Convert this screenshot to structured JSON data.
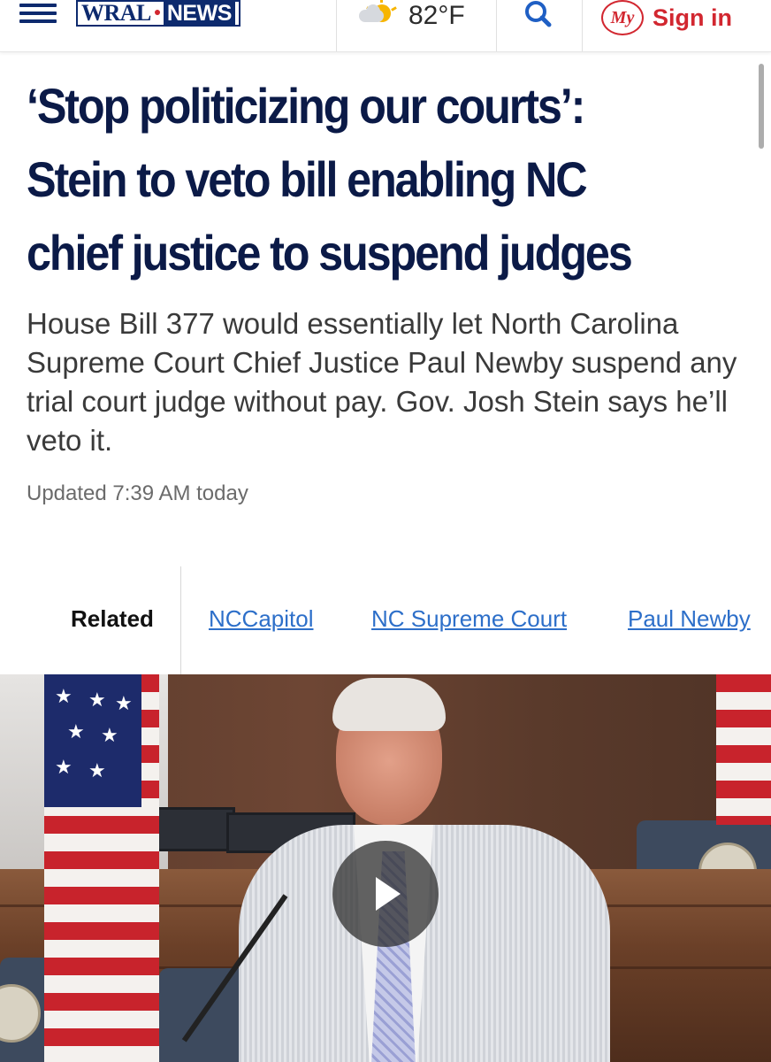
{
  "header": {
    "logo_text": "WRAL",
    "logo_news": "NEWS",
    "weather_icon": "partly-cloudy-icon",
    "temperature": "82°F",
    "search_icon": "search-icon",
    "my_badge": "My",
    "signin_label": "Sign in"
  },
  "article": {
    "headline": "‘Stop politicizing our courts’: Stein to veto bill enabling NC chief justice to suspend judges",
    "subhead": "House Bill 377 would essentially let North Carolina Supreme Court Chief Justice Paul Newby suspend any trial court judge without pay. Gov. Josh Stein says he’ll veto it.",
    "updated": "Updated 7:39 AM today"
  },
  "related": {
    "label": "Related",
    "tags": [
      "NCCapitol",
      "NC Supreme Court",
      "Paul Newby"
    ]
  },
  "media": {
    "play_icon": "play-icon"
  },
  "colors": {
    "brand_navy": "#0d2a6e",
    "accent_red": "#d22730",
    "link_blue": "#2d6fc9",
    "headline": "#0b1a47"
  }
}
